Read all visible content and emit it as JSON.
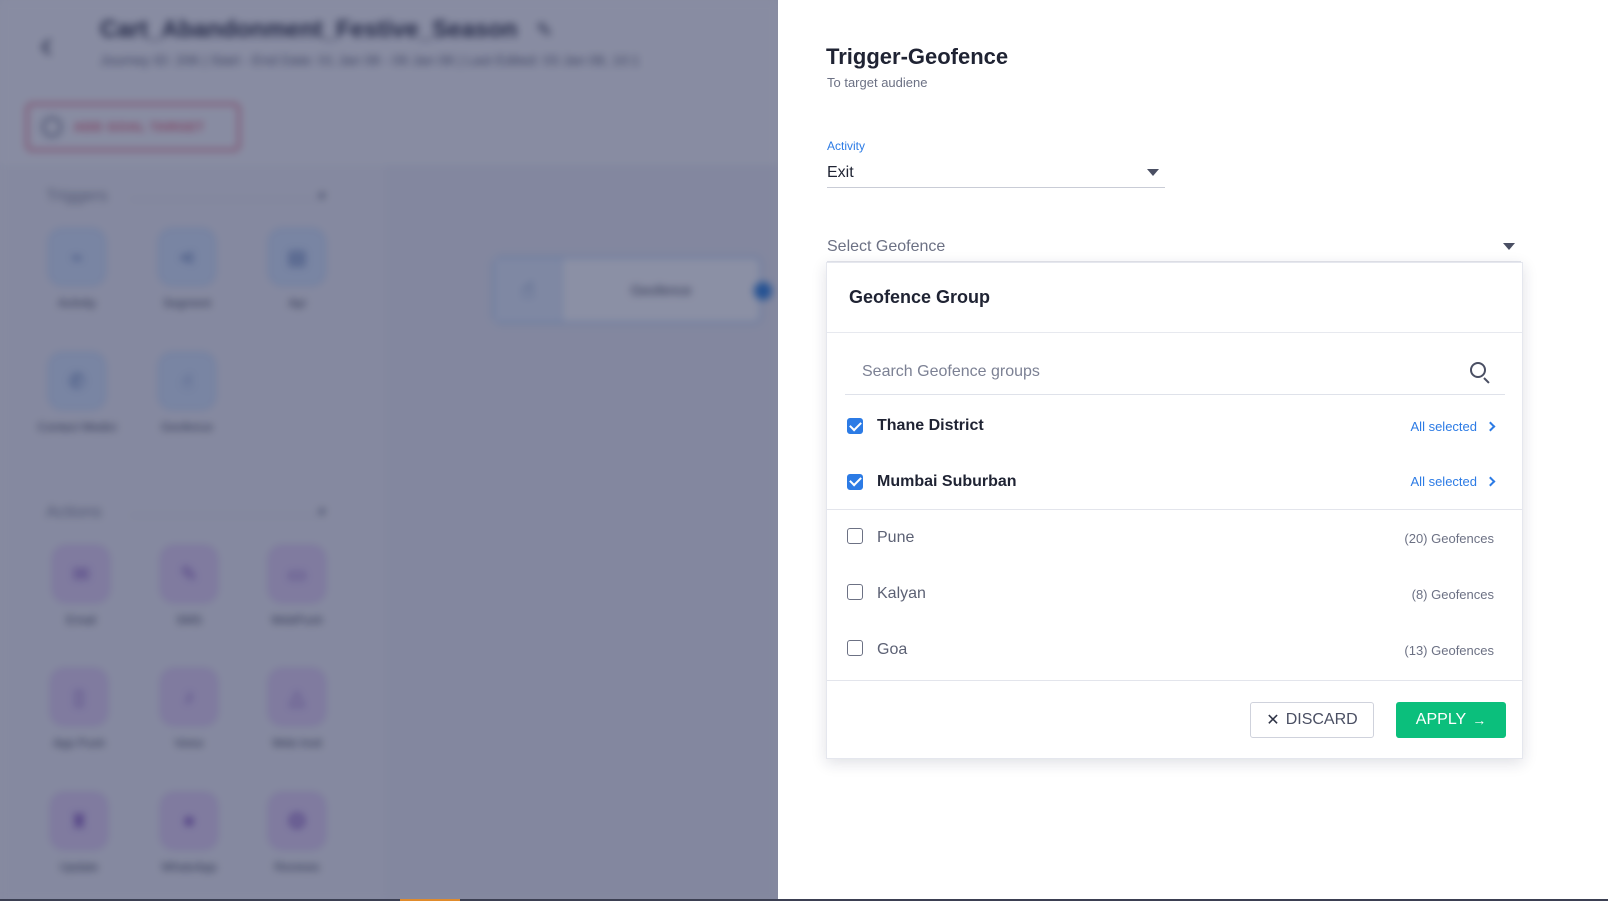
{
  "background": {
    "campaign_title": "Cart_Abandonment_Festive_Season",
    "campaign_meta": "Journey ID: 206   |   Start - End Date: 01 Jan 08 - 09 Jan 08   |   Last Edited: 03 Jan 08, 10:1",
    "goal_button": "ADD GOAL TARGET",
    "triggers_section": "Triggers",
    "actions_section": "Actions",
    "trigger_tiles": [
      "Activity",
      "Segment",
      "Api",
      "Contact Medici",
      "Geofence"
    ],
    "action_tiles": [
      "Email",
      "SMS",
      "WebPush",
      "App Push",
      "Voice",
      "Web Invit",
      "Update",
      "WhatsApp",
      "Reviews"
    ],
    "canvas_node_label": "Geofence"
  },
  "drawer": {
    "title": "Trigger-Geofence",
    "subtitle": "To target audiene",
    "activity": {
      "label": "Activity",
      "value": "Exit"
    },
    "geofence_select": {
      "label": "Select Geofence"
    },
    "panel": {
      "title": "Geofence Group",
      "search_placeholder": "Search Geofence groups",
      "groups": [
        {
          "name": "Thane District",
          "checked": true,
          "meta": "All selected"
        },
        {
          "name": "Mumbai Suburban",
          "checked": true,
          "meta": "All selected"
        },
        {
          "name": "Pune",
          "checked": false,
          "meta": "(20) Geofences"
        },
        {
          "name": "Kalyan",
          "checked": false,
          "meta": "(8) Geofences"
        },
        {
          "name": "Goa",
          "checked": false,
          "meta": "(13) Geofences"
        }
      ],
      "discard_label": "DISCARD",
      "apply_label": "APPLY"
    }
  },
  "colors": {
    "accent_blue": "#2c7be5",
    "apply_green": "#0bbf7c",
    "overlay": "#1c2248"
  },
  "icons": {
    "back": "back-chevron-icon",
    "edit": "pencil-icon",
    "search": "search-icon",
    "discard": "close-icon",
    "apply": "arrow-right-icon",
    "dropdown": "caret-down-icon",
    "expand": "chevron-right-icon"
  }
}
